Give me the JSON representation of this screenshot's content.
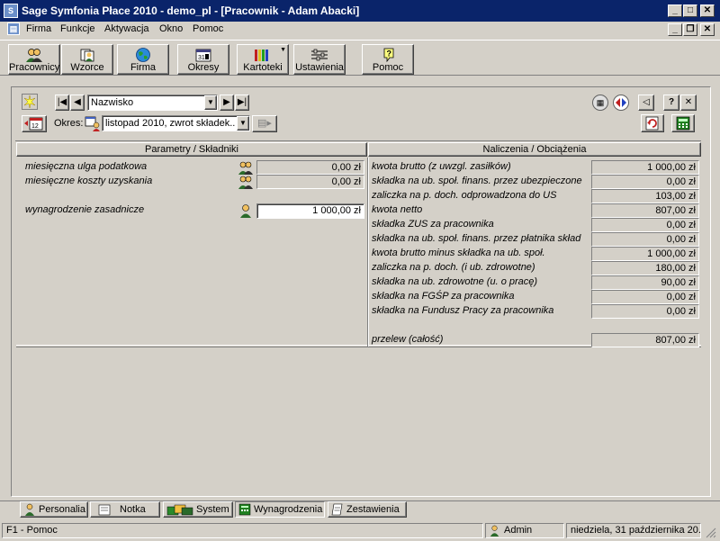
{
  "window": {
    "title": "Sage Symfonia Płace 2010 - demo_pl - [Pracownik - Adam Abacki]"
  },
  "menu": [
    "Firma",
    "Funkcje",
    "Aktywacja",
    "Okno",
    "Pomoc"
  ],
  "toolbar": {
    "pracownicy": "Pracownicy",
    "wzorce": "Wzorce",
    "firma": "Firma",
    "okresy": "Okresy",
    "kartoteki": "Kartoteki",
    "ustawienia": "Ustawienia",
    "pomoc": "Pomoc"
  },
  "nav": {
    "sort_value": "Nazwisko",
    "okres_label": "Okres:",
    "okres_value": "listopad 2010, zwrot składek..."
  },
  "left": {
    "header": "Parametry / Składniki",
    "rows": [
      {
        "label": "miesięczna ulga podatkowa",
        "value": "0,00 zł"
      },
      {
        "label": "miesięczne koszty uzyskania",
        "value": "0,00 zł"
      },
      {
        "label": "wynagrodzenie zasadnicze",
        "value": "1 000,00 zł"
      }
    ]
  },
  "right": {
    "header": "Naliczenia / Obciążenia",
    "rows": [
      {
        "label": "kwota brutto (z uwzgl. zasiłków)",
        "value": "1 000,00 zł"
      },
      {
        "label": "składka na ub. społ. finans. przez ubezpieczone",
        "value": "0,00 zł"
      },
      {
        "label": "zaliczka na p. doch. odprowadzona do US",
        "value": "103,00 zł"
      },
      {
        "label": "kwota netto",
        "value": "807,00 zł"
      },
      {
        "label": "składka ZUS za pracownika",
        "value": "0,00 zł"
      },
      {
        "label": "składka na ub. społ. finans. przez płatnika skład",
        "value": "0,00 zł"
      },
      {
        "label": "kwota brutto minus składka na ub. społ.",
        "value": "1 000,00 zł"
      },
      {
        "label": "zaliczka na p. doch. (i ub. zdrowotne)",
        "value": "180,00 zł"
      },
      {
        "label": "składka na ub. zdrowotne (u. o pracę)",
        "value": "90,00 zł"
      },
      {
        "label": "składka na FGŚP za pracownika",
        "value": "0,00 zł"
      },
      {
        "label": "składka na Fundusz Pracy za pracownika",
        "value": "0,00 zł"
      }
    ],
    "total_label": "przelew (całość)",
    "total_value": "807,00 zł"
  },
  "tabs": [
    "Personalia",
    "Notka",
    "System",
    "Wynagrodzenia",
    "Zestawienia"
  ],
  "status": {
    "help": "F1 - Pomoc",
    "user": "Admin",
    "date": "niedziela, 31 października 20..."
  },
  "colors": {
    "titlebar": "#0a246a",
    "face": "#d4d0c8"
  }
}
